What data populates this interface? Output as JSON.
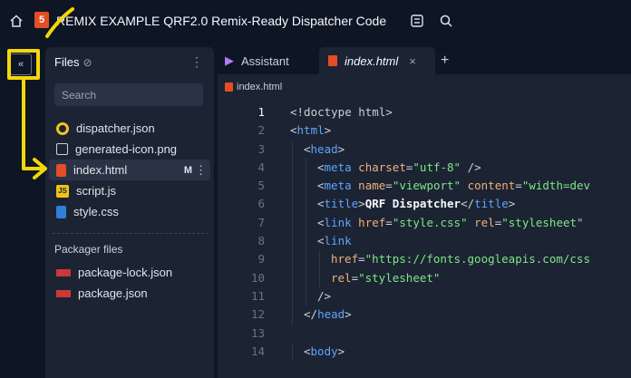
{
  "titlebar": {
    "title": "REMIX EXAMPLE QRF2.0 Remix-Ready Dispatcher Code",
    "file_badge": "5"
  },
  "rail": {
    "toggle_label": "«"
  },
  "files_panel": {
    "header": "Files",
    "search_placeholder": "Search",
    "files": [
      {
        "name": "dispatcher.json",
        "icon": "json-icon"
      },
      {
        "name": "generated-icon.png",
        "icon": "image-icon"
      },
      {
        "name": "index.html",
        "icon": "html-icon",
        "badge": "M",
        "active": true
      },
      {
        "name": "script.js",
        "icon": "js-icon"
      },
      {
        "name": "style.css",
        "icon": "css-icon"
      }
    ],
    "packager_header": "Packager files",
    "packager_files": [
      {
        "name": "package-lock.json"
      },
      {
        "name": "package.json"
      }
    ]
  },
  "editor": {
    "tabs": {
      "assistant": "Assistant",
      "index": "index.html",
      "close": "×",
      "add": "+"
    },
    "breadcrumb": "index.html",
    "current_line": 1
  },
  "code_lines": [
    {
      "n": "1",
      "indent": 0,
      "parts": [
        [
          "p",
          "<!doctype html>"
        ]
      ]
    },
    {
      "n": "2",
      "indent": 0,
      "parts": [
        [
          "p",
          "<"
        ],
        [
          "t",
          "html"
        ],
        [
          "p",
          ">"
        ]
      ]
    },
    {
      "n": "3",
      "indent": 1,
      "parts": [
        [
          "p",
          "<"
        ],
        [
          "t",
          "head"
        ],
        [
          "p",
          ">"
        ]
      ]
    },
    {
      "n": "4",
      "indent": 2,
      "parts": [
        [
          "p",
          "<"
        ],
        [
          "t",
          "meta"
        ],
        [
          "a",
          " charset"
        ],
        [
          "p",
          "="
        ],
        [
          "v",
          "\"utf-8\""
        ],
        [
          "p",
          " />"
        ]
      ]
    },
    {
      "n": "5",
      "indent": 2,
      "parts": [
        [
          "p",
          "<"
        ],
        [
          "t",
          "meta"
        ],
        [
          "a",
          " name"
        ],
        [
          "p",
          "="
        ],
        [
          "v",
          "\"viewport\""
        ],
        [
          "a",
          " content"
        ],
        [
          "p",
          "="
        ],
        [
          "v",
          "\"width=dev"
        ]
      ]
    },
    {
      "n": "6",
      "indent": 2,
      "parts": [
        [
          "p",
          "<"
        ],
        [
          "t",
          "title"
        ],
        [
          "p",
          ">"
        ],
        [
          "w",
          "QRF Dispatcher"
        ],
        [
          "p",
          "</"
        ],
        [
          "t",
          "title"
        ],
        [
          "p",
          ">"
        ]
      ]
    },
    {
      "n": "7",
      "indent": 2,
      "parts": [
        [
          "p",
          "<"
        ],
        [
          "t",
          "link"
        ],
        [
          "a",
          " href"
        ],
        [
          "p",
          "="
        ],
        [
          "v",
          "\"style.css\""
        ],
        [
          "a",
          " rel"
        ],
        [
          "p",
          "="
        ],
        [
          "v",
          "\"stylesheet\""
        ]
      ]
    },
    {
      "n": "8",
      "indent": 2,
      "parts": [
        [
          "p",
          "<"
        ],
        [
          "t",
          "link"
        ]
      ]
    },
    {
      "n": "9",
      "indent": 3,
      "parts": [
        [
          "a",
          "href"
        ],
        [
          "p",
          "="
        ],
        [
          "v",
          "\"https://fonts.googleapis.com/css"
        ]
      ]
    },
    {
      "n": "10",
      "indent": 3,
      "parts": [
        [
          "a",
          "rel"
        ],
        [
          "p",
          "="
        ],
        [
          "v",
          "\"stylesheet\""
        ]
      ]
    },
    {
      "n": "11",
      "indent": 2,
      "parts": [
        [
          "p",
          "/>"
        ]
      ]
    },
    {
      "n": "12",
      "indent": 1,
      "parts": [
        [
          "p",
          "</"
        ],
        [
          "t",
          "head"
        ],
        [
          "p",
          ">"
        ]
      ]
    },
    {
      "n": "13",
      "indent": 0,
      "parts": []
    },
    {
      "n": "14",
      "indent": 1,
      "parts": [
        [
          "p",
          "<"
        ],
        [
          "t",
          "body"
        ],
        [
          "p",
          ">"
        ]
      ]
    }
  ],
  "colors": {
    "annotation": "#f5d60a",
    "html_icon": "#e44d26",
    "js_icon": "#f0c419",
    "css_icon": "#2f7fd8",
    "json_icon": "#f0c419",
    "npm_icon": "#cb3837"
  }
}
